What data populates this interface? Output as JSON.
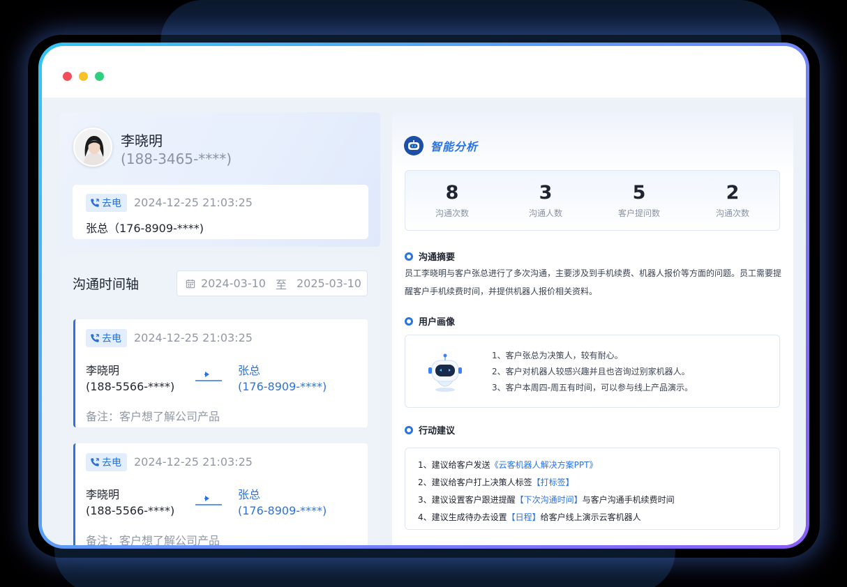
{
  "colors": {
    "accent": "#2a73e0",
    "dot_red": "#f44e5c",
    "dot_yellow": "#f6c12a",
    "dot_green": "#2fd07d"
  },
  "profile": {
    "name": "李晓明",
    "phone": "(188-3465-****)",
    "call": {
      "tag": "去电",
      "time": "2024-12-25 21:03:25",
      "callee": "张总（176-8909-****)"
    }
  },
  "timeline": {
    "title": "沟通时间轴",
    "date_from": "2024-03-10",
    "date_sep": "至",
    "date_to": "2025-03-10",
    "records": [
      {
        "tag": "去电",
        "time": "2024-12-25 21:03:25",
        "from_name": "李晓明",
        "from_phone": "(188-5566-****)",
        "to_name": "张总",
        "to_phone": "(176-8909-****)",
        "note": "备注：客户想了解公司产品"
      },
      {
        "tag": "去电",
        "time": "2024-12-25 21:03:25",
        "from_name": "李晓明",
        "from_phone": "(188-5566-****)",
        "to_name": "张总",
        "to_phone": "(176-8909-****)",
        "note": "备注：客户想了解公司产品"
      }
    ]
  },
  "analysis": {
    "title": "智能分析",
    "stats": [
      {
        "value": "8",
        "label": "沟通次数"
      },
      {
        "value": "3",
        "label": "沟通人数"
      },
      {
        "value": "5",
        "label": "客户提问数"
      },
      {
        "value": "2",
        "label": "沟通次数"
      }
    ],
    "summary_title": "沟通摘要",
    "summary_text": "员工李晓明与客户张总进行了多次沟通，主要涉及到手机续费、机器人报价等方面的问题。员工需要提醒客户手机续费时间，并提供机器人报价相关资料。",
    "portrait_title": "用户画像",
    "portrait_lines": [
      "1、客户张总为决策人，较有耐心。",
      "2、客户对机器人较感兴趣并且也咨询过别家机器人。",
      "3、客户本周四-周五有时间，可以参与线上产品演示。"
    ],
    "actions_title": "行动建议",
    "actions": [
      {
        "prefix": "1、建议给客户发送",
        "link": "《云客机器人解决方案PPT》",
        "suffix": ""
      },
      {
        "prefix": "2、建议给客户打上决策人标签",
        "link": "【打标签】",
        "suffix": ""
      },
      {
        "prefix": "3、建议设置客户跟进提醒",
        "link": "【下次沟通时间】",
        "suffix": "与客户沟通手机续费时间"
      },
      {
        "prefix": "4、建议生成待办去设置",
        "link": "【日程】",
        "suffix": "给客户线上演示云客机器人"
      }
    ]
  }
}
